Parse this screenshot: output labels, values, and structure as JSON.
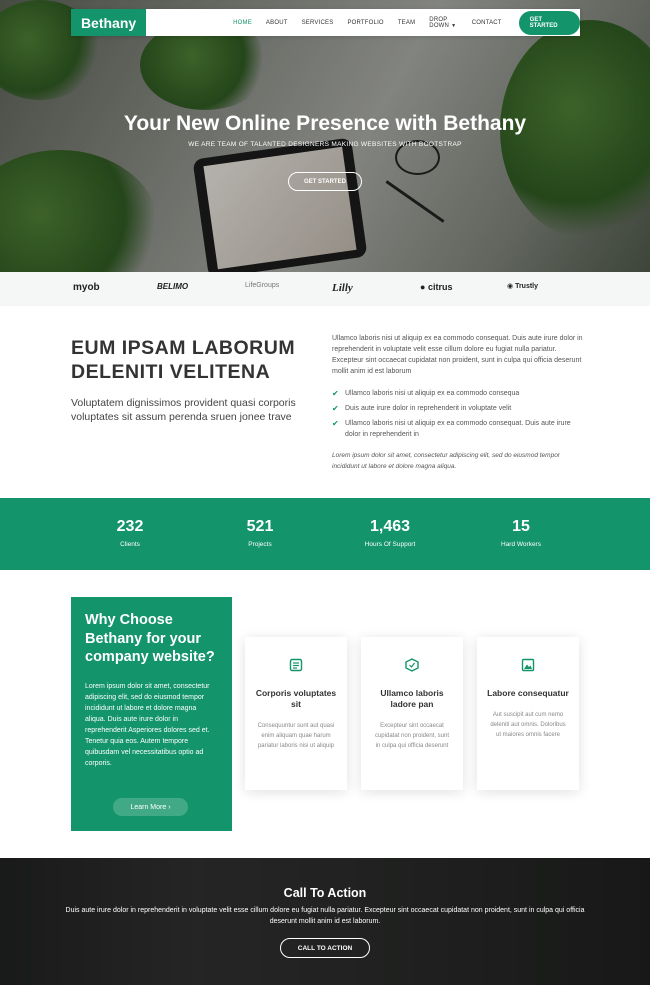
{
  "nav": {
    "brand": "Bethany",
    "links": [
      "HOME",
      "ABOUT",
      "SERVICES",
      "PORTFOLIO",
      "TEAM",
      "DROP DOWN",
      "CONTACT"
    ],
    "cta": "GET STARTED"
  },
  "hero": {
    "title": "Your New Online Presence with Bethany",
    "subtitle": "WE ARE TEAM OF TALANTED DESIGNERS MAKING WEBSITES WITH BOOTSTRAP",
    "button": "GET STARTED"
  },
  "clients": [
    "myob",
    "BELIMO",
    "LifeGroups",
    "Lilly",
    "citrus",
    "Trustly"
  ],
  "about": {
    "title": "EUM IPSAM LABORUM DELENITI VELITENA",
    "lead": "Voluptatem dignissimos provident quasi corporis voluptates sit assum perenda sruen jonee trave",
    "paragraph": "Ullamco laboris nisi ut aliquip ex ea commodo consequat. Duis aute irure dolor in reprehenderit in voluptate velit esse cillum dolore eu fugiat nulla pariatur. Excepteur sint occaecat cupidatat non proident, sunt in culpa qui officia deserunt mollit anim id est laborum",
    "checks": [
      "Ullamco laboris nisi ut aliquip ex ea commodo consequa",
      "Duis aute irure dolor in reprehenderit in voluptate velit",
      "Ullamco laboris nisi ut aliquip ex ea commodo consequat. Duis aute irure dolor in reprehenderit in"
    ],
    "italic": "Lorem ipsum dolor sit amet, consectetur adipiscing elit, sed do eiusmod tempor incididunt ut labore et dolore magna aliqua."
  },
  "counts": [
    {
      "num": "232",
      "label": "Clients"
    },
    {
      "num": "521",
      "label": "Projects"
    },
    {
      "num": "1,463",
      "label": "Hours Of Support"
    },
    {
      "num": "15",
      "label": "Hard Workers"
    }
  ],
  "why": {
    "title": "Why Choose Bethany for your company website?",
    "text": "Lorem ipsum dolor sit amet, consectetur adipiscing elit, sed do eiusmod tempor incididunt ut labore et dolore magna aliqua. Duis aute irure dolor in reprehenderit Asperiores dolores sed et. Tenetur quia eos. Autem tempore quibusdam vel necessitatibus optio ad corporis.",
    "button": "Learn More ›",
    "cards": [
      {
        "icon": "document-icon",
        "title": "Corporis voluptates sit",
        "text": "Consequuntur sunt aut quasi enim aliquam quae harum pariatur laboris nisi ut aliquip"
      },
      {
        "icon": "cube-icon",
        "title": "Ullamco laboris ladore pan",
        "text": "Excepteur sint occaecat cupidatat non proident, sunt in culpa qui officia deserunt"
      },
      {
        "icon": "image-icon",
        "title": "Labore consequatur",
        "text": "Aut suscipit aut cum nemo deleniti aut omnis. Doloribus ut maiores omnis facere"
      }
    ]
  },
  "cta": {
    "title": "Call To Action",
    "text": "Duis aute irure dolor in reprehenderit in voluptate velit esse cillum dolore eu fugiat nulla pariatur. Excepteur sint occaecat cupidatat non proident, sunt in culpa qui officia deserunt mollit anim id est laborum.",
    "button": "CALL TO ACTION"
  },
  "colors": {
    "accent": "#13946a"
  }
}
